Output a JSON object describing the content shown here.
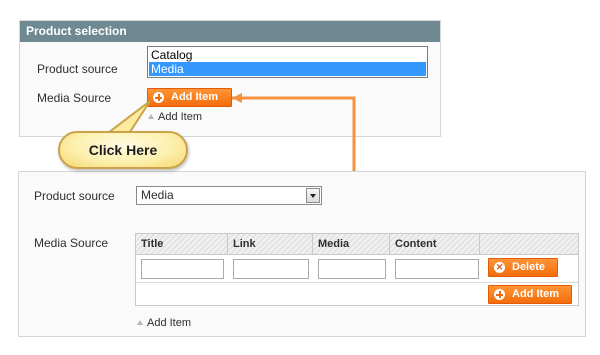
{
  "top_panel": {
    "header": "Product selection",
    "product_source_label": "Product source",
    "media_source_label": "Media Source",
    "listbox_options": [
      "Catalog",
      "Media"
    ],
    "listbox_selected": "Media",
    "add_item_button": "Add Item",
    "add_item_link": "Add Item"
  },
  "callout": {
    "text": "Click Here"
  },
  "bottom_panel": {
    "product_source_label": "Product source",
    "product_source_value": "Media",
    "media_source_label": "Media Source",
    "columns": [
      "Title",
      "Link",
      "Media",
      "Content"
    ],
    "delete_button": "Delete",
    "add_item_button": "Add Item",
    "add_item_link": "Add Item"
  },
  "colors": {
    "header": "#6f8992",
    "button": "#f36c0c",
    "arrow": "#f5923e",
    "selection": "#3399ff"
  },
  "icons": [
    "plus-circle-icon",
    "delete-circle-icon",
    "triangle-up-icon",
    "select-arrow-icon"
  ]
}
